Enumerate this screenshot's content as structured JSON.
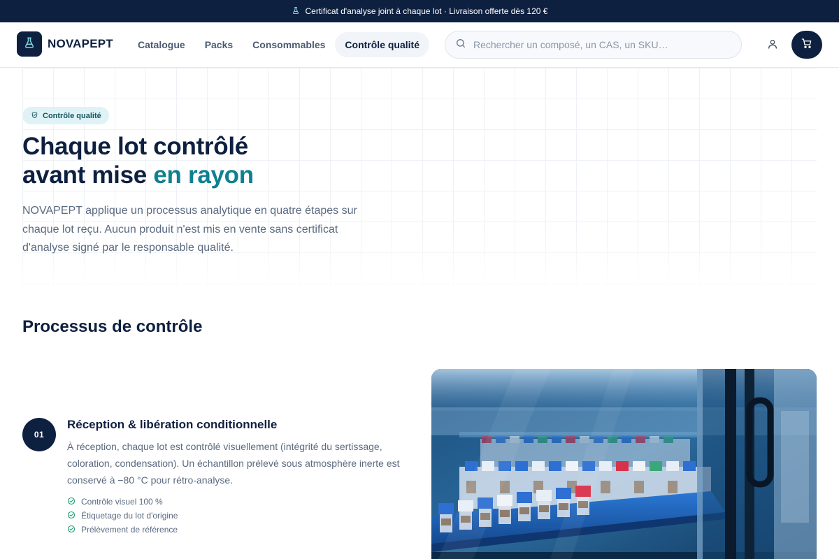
{
  "announcement": {
    "text": "Certificat d'analyse joint à chaque lot · Livraison offerte dès 120 €",
    "icon": "flask-icon"
  },
  "brand": {
    "name": "NOVAPEPT",
    "icon": "flask-icon",
    "color": "#0e2040",
    "accent": "#0f8090"
  },
  "nav": {
    "items": [
      {
        "label": "Catalogue",
        "active": false
      },
      {
        "label": "Packs",
        "active": false
      },
      {
        "label": "Consommables",
        "active": false
      },
      {
        "label": "Contrôle qualité",
        "active": true
      }
    ]
  },
  "search": {
    "placeholder": "Rechercher un composé, un CAS, un SKU…",
    "value": ""
  },
  "header_icons": {
    "account": "user-icon",
    "cart": "cart-icon"
  },
  "hero": {
    "badge": "Contrôle qualité",
    "title_line1": "Chaque lot contrôlé",
    "title_line2_prefix": "avant mise ",
    "title_line2_accent": "en rayon",
    "lead": "NOVAPEPT applique un processus analytique en quatre étapes sur chaque lot reçu. Aucun produit n'est mis en vente sans certificat d'analyse signé par le responsable qualité."
  },
  "process": {
    "title": "Processus de contrôle",
    "steps": [
      {
        "number": "01",
        "title": "Réception & libération conditionnelle",
        "description": "À réception, chaque lot est contrôlé visuellement (intégrité du sertissage, coloration, condensation). Un échantillon prélevé sous atmosphère inerte est conservé à −80 °C pour rétro-analyse.",
        "checks": [
          "Contrôle visuel 100 %",
          "Étiquetage du lot d'origine",
          "Prélèvement de référence"
        ]
      }
    ]
  }
}
